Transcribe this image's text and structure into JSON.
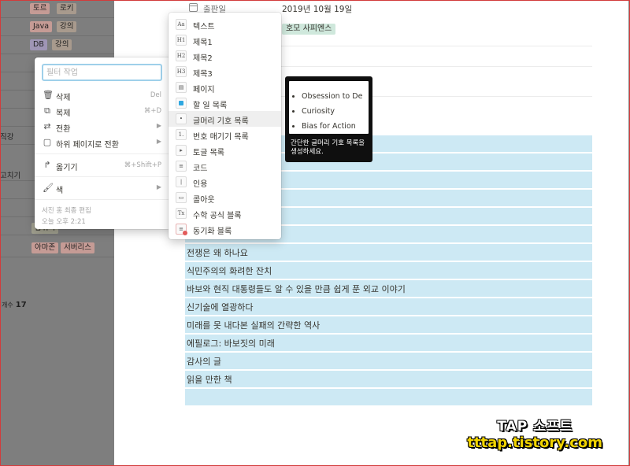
{
  "left_table": {
    "rows": [
      {
        "tags": [
          {
            "text": "토르",
            "color": "red"
          },
          {
            "text": "로키",
            "color": "brown"
          }
        ]
      },
      {
        "tags": [
          {
            "text": "Java",
            "color": "red"
          },
          {
            "text": "강의",
            "color": "brown"
          }
        ]
      },
      {
        "tags": [
          {
            "text": "DB",
            "color": "purple"
          },
          {
            "text": "강의",
            "color": "brown"
          }
        ]
      }
    ],
    "side_labels": [
      "직강",
      "고치기"
    ],
    "bottom_tags": [
      {
        "text": "합위기",
        "color": "olive"
      }
    ],
    "tags_row_last": [
      {
        "text": "아마존",
        "color": "red"
      },
      {
        "text": "서버리스",
        "color": "red"
      }
    ],
    "count_label": "개수",
    "count_value": "17"
  },
  "properties": {
    "date_label": "출판일",
    "date_value": "2019년 10월 19일",
    "tag_value": "호모 사피엔스"
  },
  "context_menu": {
    "filter_placeholder": "필터 작업",
    "items": [
      {
        "icon": "trash-icon",
        "label": "삭제",
        "shortcut": "Del"
      },
      {
        "icon": "duplicate-icon",
        "label": "복제",
        "shortcut": "⌘+D"
      },
      {
        "icon": "turn-into-icon",
        "label": "전환",
        "shortcut": ""
      },
      {
        "icon": "turn-into-page-icon",
        "label": "하위 페이지로 전환",
        "shortcut": ""
      },
      {
        "icon": "move-icon",
        "label": "옮기기",
        "shortcut": "⌘+Shift+P"
      },
      {
        "icon": "color-icon",
        "label": "색",
        "shortcut": ""
      }
    ],
    "footer_editor": "서진 홍 최종 편집",
    "footer_time": "오늘 오후 2:21"
  },
  "submenu": {
    "items": [
      {
        "icon": "Aa",
        "label": "텍스트"
      },
      {
        "icon": "H1",
        "label": "제목1"
      },
      {
        "icon": "H2",
        "label": "제목2"
      },
      {
        "icon": "H3",
        "label": "제목3"
      },
      {
        "icon": "page",
        "label": "페이지"
      },
      {
        "icon": "todo",
        "label": "할 일 목록"
      },
      {
        "icon": "bullet",
        "label": "글머리 기호 목록"
      },
      {
        "icon": "number",
        "label": "번호 매기기 목록"
      },
      {
        "icon": "toggle",
        "label": "토글 목록"
      },
      {
        "icon": "code",
        "label": "코드"
      },
      {
        "icon": "quote",
        "label": "인용"
      },
      {
        "icon": "callout",
        "label": "콜아웃"
      },
      {
        "icon": "equation",
        "label": "수학 공식 블록"
      },
      {
        "icon": "sync",
        "label": "동기화 블록"
      }
    ],
    "active_index": 6
  },
  "tooltip": {
    "preview_items": [
      "Obsession to De",
      "Curiosity",
      "Bias for Action"
    ],
    "description": "간단한 글머리 기호 목록을 생성하세요."
  },
  "toc_rows": [
    "",
    "",
    "",
    "",
    "",
    "",
    "전쟁은 왜 하나요",
    "식민주의의 화려한 잔치",
    "바보와 현직 대통령들도 알 수 있을 만큼 쉽게 푼 외교 이야기",
    "신기술에 열광하다",
    "미래를 못 내다본 실패의 간략한 역사",
    "에필로그: 바보짓의 미래",
    "감사의 글",
    "읽을 만한 책",
    ""
  ],
  "watermark": {
    "line1": "TAP 소프트",
    "line2": "tttap.tistory.com"
  }
}
